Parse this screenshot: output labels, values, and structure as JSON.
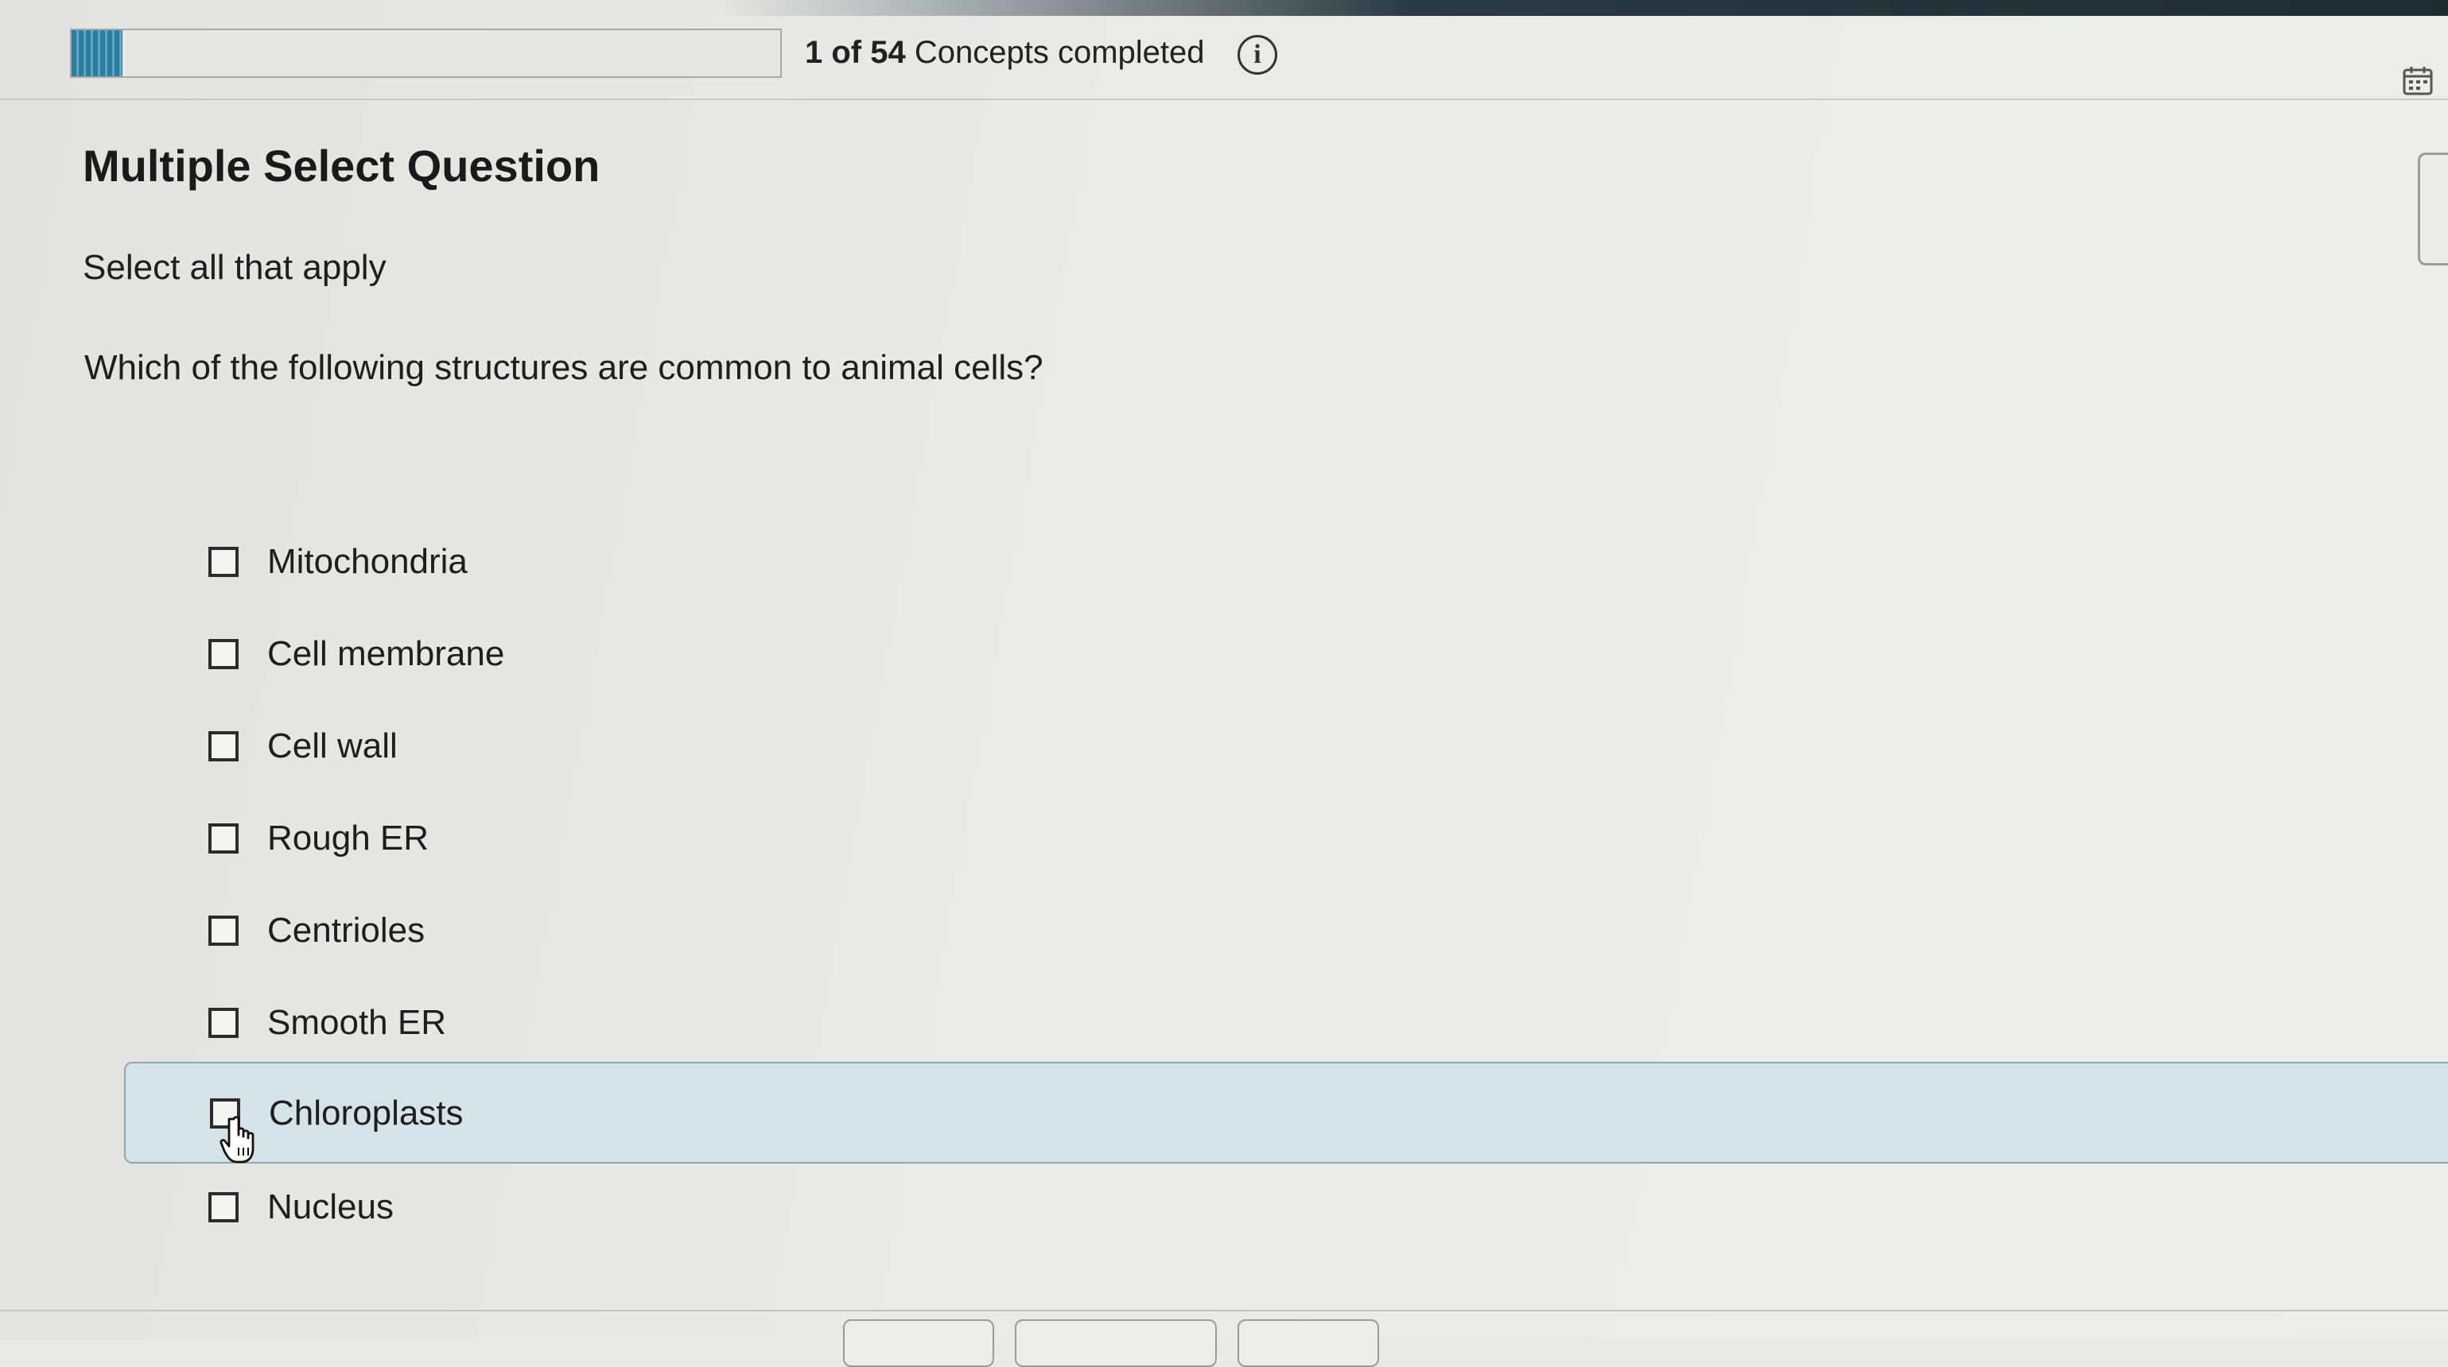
{
  "header": {
    "progress_current": "1 of 54",
    "progress_suffix": "Concepts completed",
    "progress_fraction": 0.0185,
    "info_icon": "info-icon",
    "calendar_icon": "calendar-icon"
  },
  "question": {
    "title": "Multiple Select Question",
    "instruction": "Select all that apply",
    "text": "Which of the following structures are common to animal cells?",
    "options": [
      {
        "label": "Mitochondria",
        "checked": false
      },
      {
        "label": "Cell membrane",
        "checked": false
      },
      {
        "label": "Cell wall",
        "checked": false
      },
      {
        "label": "Rough ER",
        "checked": false
      },
      {
        "label": "Centrioles",
        "checked": false
      },
      {
        "label": "Smooth ER",
        "checked": false
      },
      {
        "label": "Chloroplasts",
        "checked": false
      },
      {
        "label": "Nucleus",
        "checked": false
      }
    ]
  },
  "colors": {
    "accent": "#2a7f9e",
    "hover_row": "#d4e3e8"
  }
}
